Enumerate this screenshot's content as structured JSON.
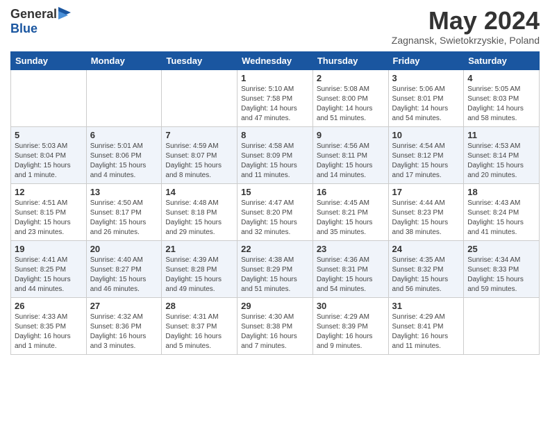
{
  "logo": {
    "general": "General",
    "blue": "Blue"
  },
  "header": {
    "month": "May 2024",
    "location": "Zagnansk, Swietokrzyskie, Poland"
  },
  "weekdays": [
    "Sunday",
    "Monday",
    "Tuesday",
    "Wednesday",
    "Thursday",
    "Friday",
    "Saturday"
  ],
  "weeks": [
    [
      {
        "day": "",
        "info": ""
      },
      {
        "day": "",
        "info": ""
      },
      {
        "day": "",
        "info": ""
      },
      {
        "day": "1",
        "info": "Sunrise: 5:10 AM\nSunset: 7:58 PM\nDaylight: 14 hours and 47 minutes."
      },
      {
        "day": "2",
        "info": "Sunrise: 5:08 AM\nSunset: 8:00 PM\nDaylight: 14 hours and 51 minutes."
      },
      {
        "day": "3",
        "info": "Sunrise: 5:06 AM\nSunset: 8:01 PM\nDaylight: 14 hours and 54 minutes."
      },
      {
        "day": "4",
        "info": "Sunrise: 5:05 AM\nSunset: 8:03 PM\nDaylight: 14 hours and 58 minutes."
      }
    ],
    [
      {
        "day": "5",
        "info": "Sunrise: 5:03 AM\nSunset: 8:04 PM\nDaylight: 15 hours and 1 minute."
      },
      {
        "day": "6",
        "info": "Sunrise: 5:01 AM\nSunset: 8:06 PM\nDaylight: 15 hours and 4 minutes."
      },
      {
        "day": "7",
        "info": "Sunrise: 4:59 AM\nSunset: 8:07 PM\nDaylight: 15 hours and 8 minutes."
      },
      {
        "day": "8",
        "info": "Sunrise: 4:58 AM\nSunset: 8:09 PM\nDaylight: 15 hours and 11 minutes."
      },
      {
        "day": "9",
        "info": "Sunrise: 4:56 AM\nSunset: 8:11 PM\nDaylight: 15 hours and 14 minutes."
      },
      {
        "day": "10",
        "info": "Sunrise: 4:54 AM\nSunset: 8:12 PM\nDaylight: 15 hours and 17 minutes."
      },
      {
        "day": "11",
        "info": "Sunrise: 4:53 AM\nSunset: 8:14 PM\nDaylight: 15 hours and 20 minutes."
      }
    ],
    [
      {
        "day": "12",
        "info": "Sunrise: 4:51 AM\nSunset: 8:15 PM\nDaylight: 15 hours and 23 minutes."
      },
      {
        "day": "13",
        "info": "Sunrise: 4:50 AM\nSunset: 8:17 PM\nDaylight: 15 hours and 26 minutes."
      },
      {
        "day": "14",
        "info": "Sunrise: 4:48 AM\nSunset: 8:18 PM\nDaylight: 15 hours and 29 minutes."
      },
      {
        "day": "15",
        "info": "Sunrise: 4:47 AM\nSunset: 8:20 PM\nDaylight: 15 hours and 32 minutes."
      },
      {
        "day": "16",
        "info": "Sunrise: 4:45 AM\nSunset: 8:21 PM\nDaylight: 15 hours and 35 minutes."
      },
      {
        "day": "17",
        "info": "Sunrise: 4:44 AM\nSunset: 8:23 PM\nDaylight: 15 hours and 38 minutes."
      },
      {
        "day": "18",
        "info": "Sunrise: 4:43 AM\nSunset: 8:24 PM\nDaylight: 15 hours and 41 minutes."
      }
    ],
    [
      {
        "day": "19",
        "info": "Sunrise: 4:41 AM\nSunset: 8:25 PM\nDaylight: 15 hours and 44 minutes."
      },
      {
        "day": "20",
        "info": "Sunrise: 4:40 AM\nSunset: 8:27 PM\nDaylight: 15 hours and 46 minutes."
      },
      {
        "day": "21",
        "info": "Sunrise: 4:39 AM\nSunset: 8:28 PM\nDaylight: 15 hours and 49 minutes."
      },
      {
        "day": "22",
        "info": "Sunrise: 4:38 AM\nSunset: 8:29 PM\nDaylight: 15 hours and 51 minutes."
      },
      {
        "day": "23",
        "info": "Sunrise: 4:36 AM\nSunset: 8:31 PM\nDaylight: 15 hours and 54 minutes."
      },
      {
        "day": "24",
        "info": "Sunrise: 4:35 AM\nSunset: 8:32 PM\nDaylight: 15 hours and 56 minutes."
      },
      {
        "day": "25",
        "info": "Sunrise: 4:34 AM\nSunset: 8:33 PM\nDaylight: 15 hours and 59 minutes."
      }
    ],
    [
      {
        "day": "26",
        "info": "Sunrise: 4:33 AM\nSunset: 8:35 PM\nDaylight: 16 hours and 1 minute."
      },
      {
        "day": "27",
        "info": "Sunrise: 4:32 AM\nSunset: 8:36 PM\nDaylight: 16 hours and 3 minutes."
      },
      {
        "day": "28",
        "info": "Sunrise: 4:31 AM\nSunset: 8:37 PM\nDaylight: 16 hours and 5 minutes."
      },
      {
        "day": "29",
        "info": "Sunrise: 4:30 AM\nSunset: 8:38 PM\nDaylight: 16 hours and 7 minutes."
      },
      {
        "day": "30",
        "info": "Sunrise: 4:29 AM\nSunset: 8:39 PM\nDaylight: 16 hours and 9 minutes."
      },
      {
        "day": "31",
        "info": "Sunrise: 4:29 AM\nSunset: 8:41 PM\nDaylight: 16 hours and 11 minutes."
      },
      {
        "day": "",
        "info": ""
      }
    ]
  ]
}
